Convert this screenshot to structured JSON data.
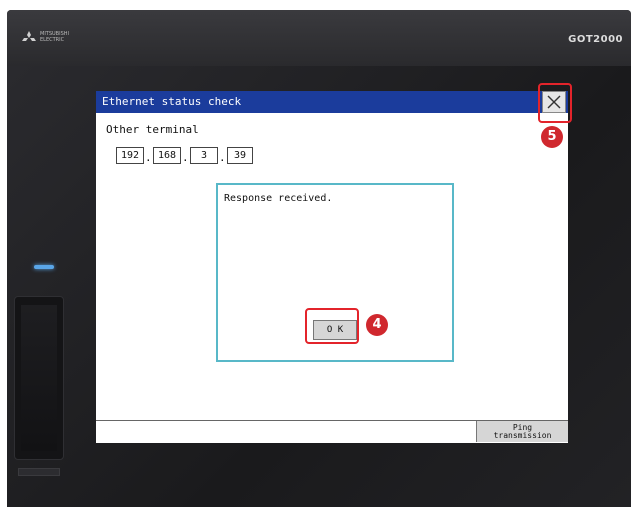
{
  "device": {
    "brand": "MITSUBISHI\nELECTRIC",
    "model": "GOT2000"
  },
  "window": {
    "title": "Ethernet status check"
  },
  "terminal": {
    "label": "Other terminal",
    "ip": [
      "192",
      "168",
      "3",
      "39"
    ],
    "separator": "."
  },
  "dialog": {
    "message": "Response received.",
    "ok_label": "O K"
  },
  "footer": {
    "ping_label_line1": "Ping",
    "ping_label_line2": "transmission"
  },
  "annotations": {
    "ok_step": "4",
    "close_step": "5"
  },
  "colors": {
    "titlebar": "#1b3c9c",
    "dialog_border": "#58b8c8",
    "callout": "#e3242b",
    "led": "#5aa6e8"
  }
}
